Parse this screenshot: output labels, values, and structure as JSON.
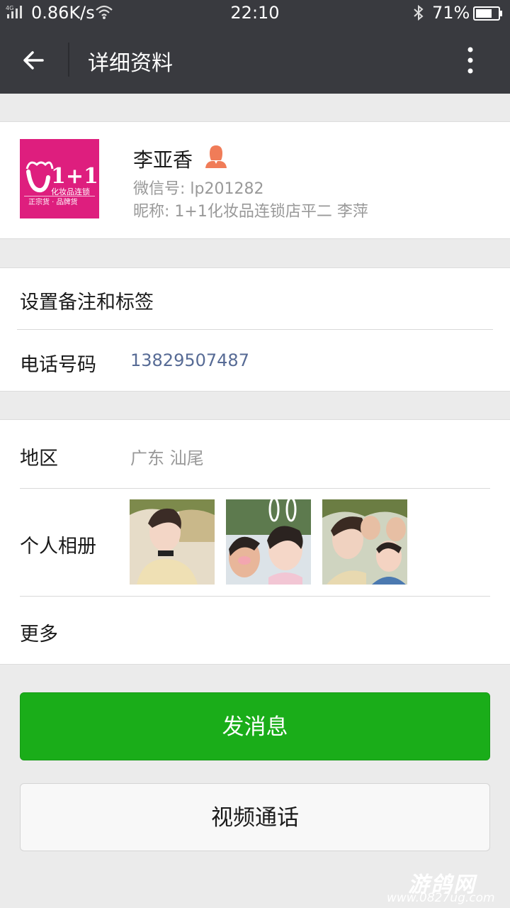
{
  "status_bar": {
    "network_speed": "0.86K/s",
    "time": "22:10",
    "battery": "71%",
    "signal_label": "4G",
    "icons": [
      "signal-icon",
      "wifi-icon",
      "bluetooth-icon",
      "battery-icon"
    ]
  },
  "header": {
    "title": "详细资料",
    "back_icon": "back-arrow-icon",
    "menu_icon": "more-vertical-icon"
  },
  "profile": {
    "name": "李亚香",
    "gender_icon": "female-icon",
    "wechat_id": "微信号: lp201282",
    "nickname": "昵称: 1+1化妆品连锁店平二  李萍",
    "avatar": {
      "main": "1+1",
      "sub": "化妆品连锁",
      "tagline": "正宗货 · 品牌货",
      "bg_color": "#de1e7e"
    }
  },
  "rows": {
    "remark_label": "设置备注和标签",
    "phone_label": "电话号码",
    "phone_value": "13829507487",
    "region_label": "地区",
    "region_value": "广东  汕尾",
    "album_label": "个人相册",
    "more_label": "更多"
  },
  "buttons": {
    "message": "发消息",
    "video_call": "视频通话"
  },
  "watermark": {
    "line1": "游鸽网",
    "line2": "www.0827ug.com"
  },
  "colors": {
    "titlebar": "#393a3f",
    "link": "#576b95",
    "primary_green": "#1aad19",
    "female": "#f07c58"
  }
}
